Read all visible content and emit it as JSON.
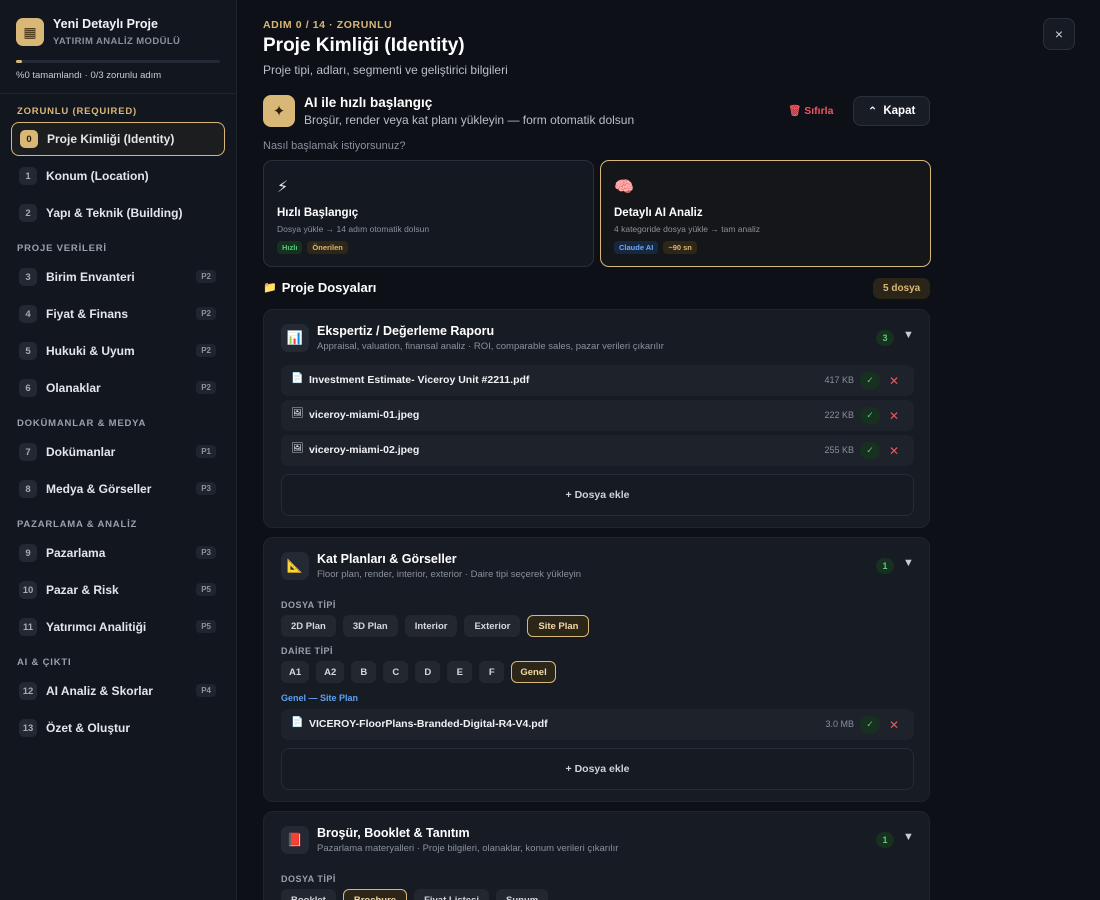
{
  "sidebar": {
    "logo_icon": "building-icon",
    "title": "Yeni Detaylı Proje",
    "subtitle": "YATIRIM ANALİZ MODÜLÜ",
    "progress_text": "%0 tamamlandı · 0/3 zorunlu adım",
    "progress_fraction": 0.03,
    "sections": {
      "required": "ZORUNLU (REQUIRED)",
      "project_data": "PROJE VERİLERİ",
      "docs_media": "DOKÜMANLAR & MEDYA",
      "marketing": "PAZARLAMA & ANALİZ",
      "ai_output": "AI & ÇIKTI"
    },
    "items": [
      {
        "num": "0",
        "label": "Proje Kimliği (Identity)",
        "badge": ""
      },
      {
        "num": "1",
        "label": "Konum (Location)",
        "badge": ""
      },
      {
        "num": "2",
        "label": "Yapı & Teknik (Building)",
        "badge": ""
      },
      {
        "num": "3",
        "label": "Birim Envanteri",
        "badge": "P2"
      },
      {
        "num": "4",
        "label": "Fiyat & Finans",
        "badge": "P2"
      },
      {
        "num": "5",
        "label": "Hukuki & Uyum",
        "badge": "P2"
      },
      {
        "num": "6",
        "label": "Olanaklar",
        "badge": "P2"
      },
      {
        "num": "7",
        "label": "Dokümanlar",
        "badge": "P1"
      },
      {
        "num": "8",
        "label": "Medya & Görseller",
        "badge": "P3"
      },
      {
        "num": "9",
        "label": "Pazarlama",
        "badge": "P3"
      },
      {
        "num": "10",
        "label": "Pazar & Risk",
        "badge": "P5"
      },
      {
        "num": "11",
        "label": "Yatırımcı Analitiği",
        "badge": "P5"
      },
      {
        "num": "12",
        "label": "AI Analiz & Skorlar",
        "badge": "P4"
      },
      {
        "num": "13",
        "label": "Özet & Oluştur",
        "badge": ""
      }
    ]
  },
  "header": {
    "step_tag": "ADIM 0 / 14 · ZORUNLU",
    "title": "Proje Kimliği (Identity)",
    "subtitle": "Proje tipi, adları, segmenti ve geliştirici bilgileri",
    "close_label": "×"
  },
  "ai_start": {
    "title": "AI ile hızlı başlangıç",
    "subtitle": "Broşür, render veya kat planı yükleyin — form otomatik dolsun",
    "reset_label": "Sıfırla",
    "collapse_label": "Kapat",
    "how_start": "Nasıl başlamak istiyorsunuz?",
    "modes": [
      {
        "icon": "⚡",
        "title": "Hızlı Başlangıç",
        "desc": "Dosya yükle → 14 adım otomatik dolsun",
        "tags": [
          {
            "text": "Hızlı",
            "color": "green"
          },
          {
            "text": "Önerilen",
            "color": "gold"
          }
        ]
      },
      {
        "icon": "🧠",
        "title": "Detaylı AI Analiz",
        "desc": "4 kategoride dosya yükle → tam analiz",
        "tags": [
          {
            "text": "Claude AI",
            "color": "blue"
          },
          {
            "text": "~90 sn",
            "color": "gold"
          }
        ]
      }
    ]
  },
  "files": {
    "title": "Proje Dosyaları",
    "count_label": "5 dosya",
    "add_label": "+ Dosya ekle",
    "panels": [
      {
        "icon": "📊",
        "title": "Ekspertiz / Değerleme Raporu",
        "subtitle": "Appraisal, valuation, finansal analiz · ROI, comparable sales, pazar verileri çıkarılır",
        "count": "3",
        "files": [
          {
            "icon": "📄",
            "name": "Investment Estimate- Viceroy Unit #2211.pdf",
            "size": "417 KB"
          },
          {
            "icon": "🖼",
            "name": "viceroy-miami-01.jpeg",
            "size": "222 KB"
          },
          {
            "icon": "🖼",
            "name": "viceroy-miami-02.jpeg",
            "size": "255 KB"
          }
        ]
      },
      {
        "icon": "📐",
        "title": "Kat Planları & Görseller",
        "subtitle": "Floor plan, render, interior, exterior · Daire tipi seçerek yükleyin",
        "count": "1",
        "file_type_label": "DOSYA TİPİ",
        "file_types": [
          "2D Plan",
          "3D Plan",
          "Interior",
          "Exterior",
          "Site Plan"
        ],
        "active_file_type": "Site Plan",
        "unit_type_label": "DAİRE TİPİ",
        "unit_types": [
          "A1",
          "A2",
          "B",
          "C",
          "D",
          "E",
          "F",
          "Genel"
        ],
        "active_unit_type": "Genel",
        "selection_path": "Genel — Site Plan",
        "files": [
          {
            "icon": "📄",
            "name": "VICEROY-FloorPlans-Branded-Digital-R4-V4.pdf",
            "size": "3.0 MB"
          }
        ]
      },
      {
        "icon": "📕",
        "title": "Broşür, Booklet & Tanıtım",
        "subtitle": "Pazarlama materyalleri · Proje bilgileri, olanaklar, konum verileri çıkarılır",
        "count": "1",
        "file_type_label": "DOSYA TİPİ",
        "file_types": [
          "Booklet",
          "Brochure",
          "Fiyat Listesi",
          "Sunum"
        ],
        "active_file_type": "Brochure"
      }
    ]
  },
  "colors": {
    "accent": "#d9b776",
    "danger": "#f0555b",
    "success": "#58c97a",
    "link": "#5fa0f0",
    "bg": "#0d1017"
  }
}
